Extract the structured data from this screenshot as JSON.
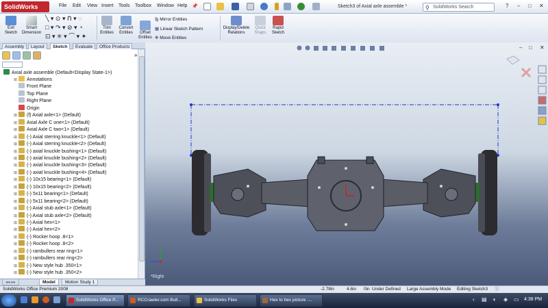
{
  "app": {
    "logo_text": "SolidWorks",
    "menus": [
      "File",
      "Edit",
      "View",
      "Insert",
      "Tools",
      "Toolbox",
      "Window",
      "Help"
    ],
    "pin_icon": "pin-icon",
    "document_title": "Sketch3 of Axial axle assemble *",
    "search_placeholder": "SolidWorks Search",
    "help_label": "?",
    "window_controls": [
      "–",
      "□",
      "✕"
    ]
  },
  "ribbon": {
    "exit_sketch": "Exit Sketch",
    "smart_dimension": "Smart Dimension",
    "trim_entities": "Trim Entities",
    "convert_entities": "Convert Entities",
    "offset_entities": "Offset Entities",
    "mirror_entities": "Mirror Entities",
    "linear_sketch_pattern": "Linear Sketch Pattern",
    "move_entities": "Move Entities",
    "display_delete_relations": "Display/Delete Relations",
    "quick_snaps": "Quick Snaps",
    "rapid_sketch": "Rapid Sketch"
  },
  "command_tabs": [
    "Assembly",
    "Layout",
    "Sketch",
    "Evaluate",
    "Office Products"
  ],
  "active_tab": "Sketch",
  "panel": {
    "expand_arrows": "»",
    "root": "Axial axle assemble  (Default<Display State-1>)",
    "items": [
      "Annotations",
      "Front Plane",
      "Top Plane",
      "Right Plane",
      "Origin",
      "(f) Axial axle<1> (Default)",
      "Axial Axle C one<1> (Default)",
      "Axial Axle C two<1> (Default)",
      "(-) Axial sterring knuckle<1> (Default)",
      "(-) Axial sterring knuckle<2> (Default)",
      "(-) axial knuckle bushing<1> (Default)",
      "(-) axial knuckle bushing<2> (Default)",
      "(-) axial knuckle bushing<3> (Default)",
      "(-) axial knuckle bushing<4> (Default)",
      "(-) 10x15 bearing<1> (Default)",
      "(-) 10x15 bearing<2> (Default)",
      "(-) 5x11 bearing<1> (Default)",
      "(-) 5x11 bearing<2> (Default)",
      "(-) Axial stub axle<1> (Default)",
      "(-) Axial stub axle<2> (Default)",
      "(-) Axial hex<1>",
      "(-) Axial hex<2>",
      "(-) Rocker hoop .8<1>",
      "(-) Rocker hoop .8<2>",
      "(-) rambullers rear ring<1>",
      "(-) rambullers rear ring<2>",
      "(-) New style hub .350<1>",
      "(-) New style hub .350<2>"
    ]
  },
  "bottom_tabs": [
    "Model",
    "Motion Study 1"
  ],
  "viewport": {
    "view_label": "*Right",
    "vp_controls": [
      "–",
      "□",
      "✕"
    ]
  },
  "status": {
    "edition": "SolidWorks Office Premium 2008",
    "x": "-2.78in",
    "y": "4.6in",
    "z": "0in",
    "state": "Under Defined",
    "mode": "Large Assembly Mode",
    "editing": "Editing Sketch3"
  },
  "taskbar": {
    "items": [
      "SolidWorks Office P...",
      "RCCrawler.com Bull...",
      "SolidWorks Files",
      "Hex to hex picture -..."
    ],
    "clock": "4:38 PM"
  },
  "colors": {
    "accent": "#c0282d",
    "viewport_top": "#e9eef4",
    "viewport_bottom": "#4c5a7a",
    "sketch_blue": "#2233cc"
  }
}
